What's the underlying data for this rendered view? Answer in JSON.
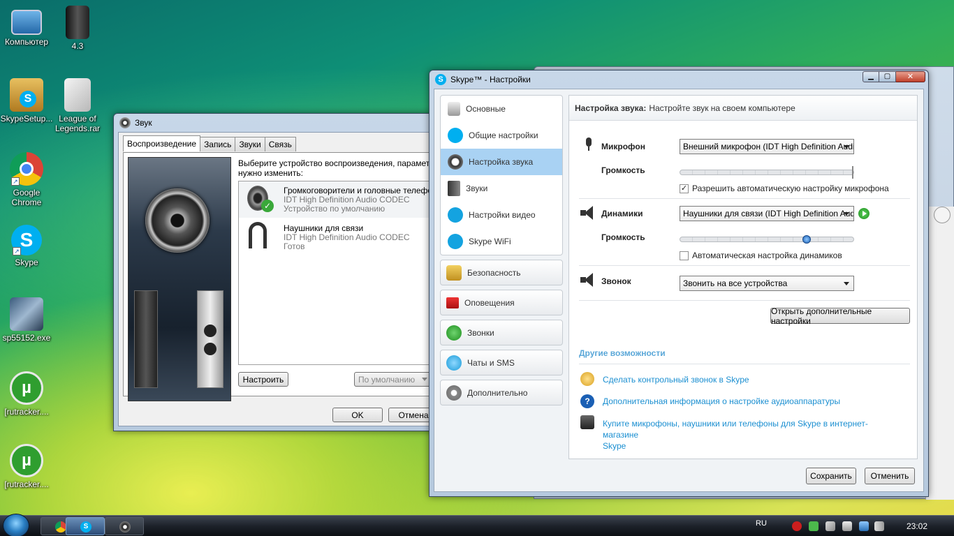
{
  "desktop": {
    "icons": [
      {
        "label": "Компьютер"
      },
      {
        "label": "4.3"
      },
      {
        "label": "SkypeSetup..."
      },
      {
        "label": "League of Legends.rar"
      },
      {
        "label": "Google Chrome"
      },
      {
        "label": "Skype"
      },
      {
        "label": "sp55152.exe"
      },
      {
        "label": "[rutracker...."
      },
      {
        "label": "[rutracker...."
      }
    ]
  },
  "sound_window": {
    "title": "Звук",
    "tabs": [
      "Воспроизведение",
      "Запись",
      "Звуки",
      "Связь"
    ],
    "instruction": "Выберите устройство воспроизведения, параметры которого нужно изменить:",
    "instruction_line1": "Выберите устройство воспроизведения, параметры",
    "instruction_line2": "нужно изменить:",
    "devices": [
      {
        "name": "Громкоговорители и головные телефоны",
        "driver": "IDT High Definition Audio CODEC",
        "status": "Устройство по умолчанию"
      },
      {
        "name": "Наушники для связи",
        "driver": "IDT High Definition Audio CODEC",
        "status": "Готов"
      }
    ],
    "configure_button": "Настроить",
    "default_button": "По умолчанию",
    "ok_button": "OK",
    "cancel_button": "Отмена"
  },
  "skype_window": {
    "title": "Skype™ - Настройки",
    "nav_group": [
      {
        "label": "Основные",
        "icon": "general-icon"
      },
      {
        "label": "Общие настройки",
        "icon": "skype-icon"
      },
      {
        "label": "Настройка звука",
        "icon": "sound-settings-icon"
      },
      {
        "label": "Звуки",
        "icon": "speaker-icon"
      },
      {
        "label": "Настройки видео",
        "icon": "video-icon"
      },
      {
        "label": "Skype WiFi",
        "icon": "wifi-icon"
      }
    ],
    "nav_buttons": [
      {
        "label": "Безопасность",
        "icon": "lock-icon"
      },
      {
        "label": "Оповещения",
        "icon": "flag-icon"
      },
      {
        "label": "Звонки",
        "icon": "phone-icon"
      },
      {
        "label": "Чаты и SMS",
        "icon": "chat-icon"
      },
      {
        "label": "Дополнительно",
        "icon": "gear-icon"
      }
    ],
    "header_bold": "Настройка звука:",
    "header_text": "Настройте звук на своем компьютере",
    "microphone": {
      "label": "Микрофон",
      "device": "Внешний микрофон (IDT High Definition Audio",
      "volume_label": "Громкость",
      "volume_level": 1.0,
      "auto_checkbox": "Разрешить автоматическую настройку микрофона",
      "auto_checked": true
    },
    "speakers": {
      "label": "Динамики",
      "device": "Наушники для связи (IDT High Definition Audio",
      "volume_label": "Громкость",
      "volume_level": 0.74,
      "auto_checkbox": "Автоматическая настройка динамиков",
      "auto_checked": false
    },
    "ringer": {
      "label": "Звонок",
      "device": "Звонить на все устройства"
    },
    "advanced_button": "Открыть дополнительные настройки",
    "other_title": "Другие возможности",
    "links": [
      {
        "text": "Сделать контрольный звонок в Skype"
      },
      {
        "text": "Дополнительная информация о настройке аудиоаппаратуры"
      },
      {
        "text": "Купите микрофоны, наушники или телефоны для Skype в интернет-магазине"
      },
      {
        "text": "Skype"
      }
    ],
    "save_button": "Сохранить",
    "cancel_button": "Отменить",
    "check_mark": "✓"
  },
  "taskbar": {
    "language": "RU",
    "clock": "23:02"
  },
  "colors": {
    "link": "#1b8fd1",
    "nav_selected": "#a9d2f3",
    "skype_blue": "#00aff0"
  }
}
